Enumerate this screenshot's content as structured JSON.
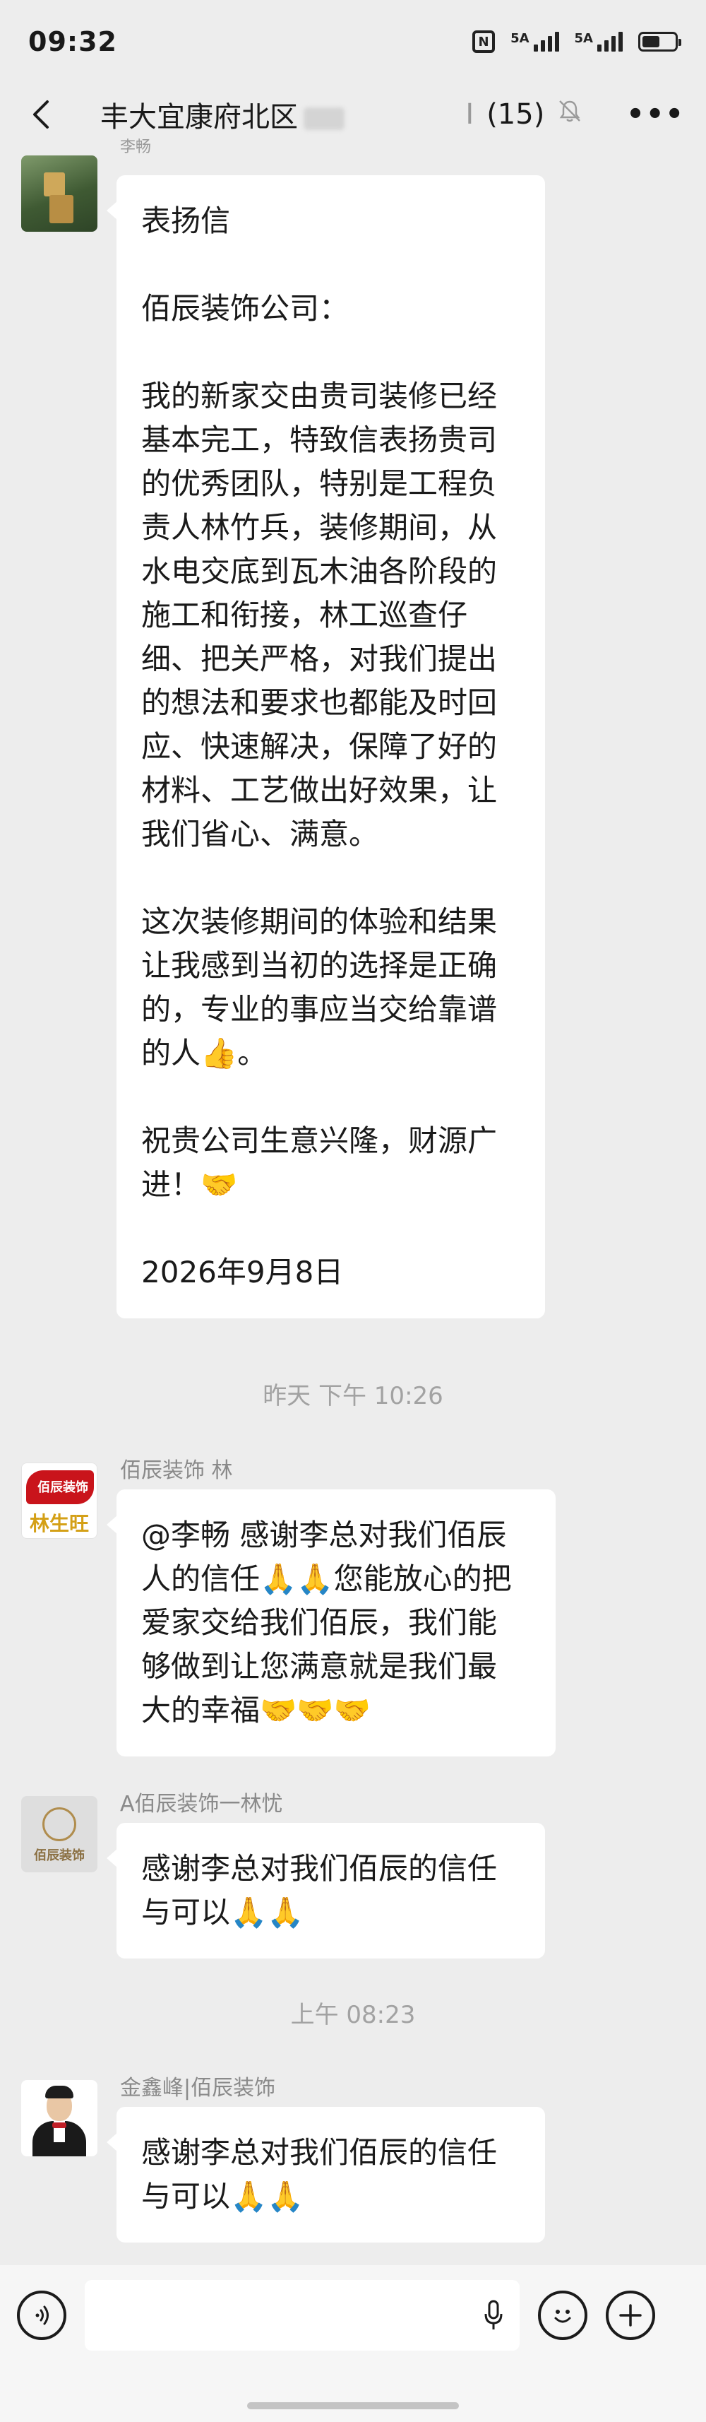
{
  "status_bar": {
    "time": "09:32",
    "nfc_label": "N",
    "signal_1_label": "5A",
    "signal_2_label": "5A",
    "icons": [
      "nfc-icon",
      "signal-icon",
      "signal-icon",
      "battery-icon"
    ]
  },
  "nav": {
    "title": "丰大宜康府北区",
    "member_count": "(15)",
    "icons": [
      "back-chevron-icon",
      "mute-bell-icon",
      "more-dots-icon"
    ]
  },
  "messages": [
    {
      "sender": "李畅",
      "avatar": "green-photo-avatar",
      "lines": [
        "表扬信",
        "",
        "佰辰装饰公司：",
        "",
        "我的新家交由贵司装修已经",
        "基本完工，特致信表扬贵司",
        "的优秀团队，特别是工程负",
        "责人林竹兵，装修期间，从",
        "水电交底到瓦木油各阶段的",
        "施工和衔接，林工巡查仔",
        "细、把关严格，对我们提出",
        "的想法和要求也都能及时回",
        "应、快速解决，保障了好的",
        "材料、工艺做出好效果，让",
        "我们省心、满意。",
        "",
        "这次装修期间的体验和结果",
        "让我感到当初的选择是正确",
        "的，专业的事应当交给靠谱",
        "的人👍。",
        "",
        "祝贵公司生意兴隆，财源广",
        "进！🤝",
        "",
        "2026年9月8日"
      ]
    },
    {
      "sender": "佰辰装饰  林",
      "avatar_logo_text": "佰辰装饰",
      "avatar_name": "林生旺",
      "lines": [
        "@李畅 感谢李总对我们佰辰",
        "人的信任🙏🙏您能放心的把",
        "爱家交给我们佰辰，我们能",
        "够做到让您满意就是我们最",
        "大的幸福🤝🤝🤝"
      ]
    },
    {
      "sender": "A佰辰装饰一林忧",
      "avatar_text": "佰辰装饰",
      "lines": [
        "感谢李总对我们佰辰的信任",
        "与可以🙏🙏"
      ]
    },
    {
      "sender": "金鑫峰|佰辰装饰",
      "avatar": "man-bowtie-avatar",
      "lines": [
        "感谢李总对我们佰辰的信任",
        "与可以🙏🙏"
      ]
    }
  ],
  "timestamps": [
    "昨天 下午 10:26",
    "上午 08:23"
  ],
  "input_bar": {
    "placeholder": "",
    "icons": [
      "voice-icon",
      "mic-icon",
      "emoji-icon",
      "plus-icon"
    ]
  }
}
